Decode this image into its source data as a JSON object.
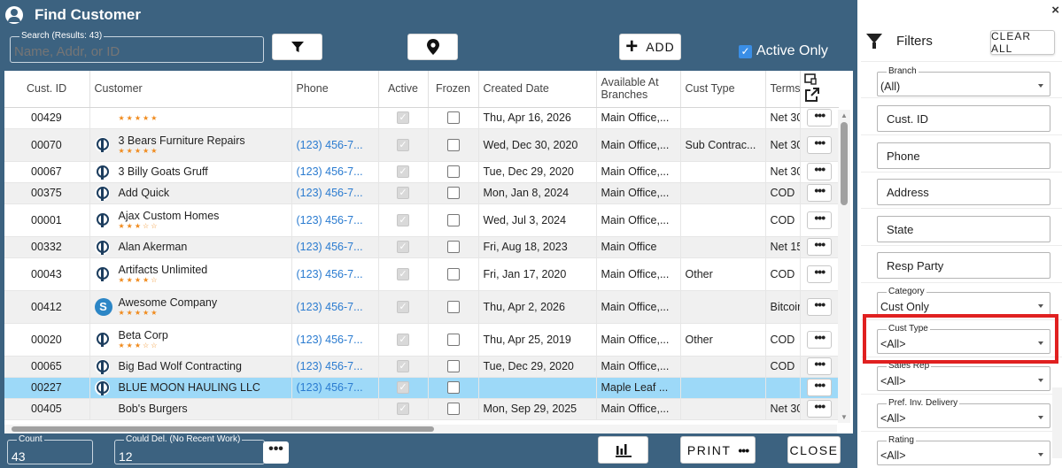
{
  "window": {
    "title": "Find Customer"
  },
  "search": {
    "legend": "Search (Results: 43)",
    "placeholder": "Name, Addr, or ID"
  },
  "toolbar": {
    "add_label": "ADD",
    "active_only_label": "Active Only",
    "active_only_checked": true
  },
  "grid": {
    "columns": [
      "Cust. ID",
      "Customer",
      "Phone",
      "Active",
      "Frozen",
      "Created Date",
      "Available At Branches",
      "Cust Type",
      "Terms"
    ],
    "rows": [
      {
        "id": "00429",
        "name": "",
        "rating": 5,
        "logo": "",
        "phone": "",
        "active": true,
        "frozen": false,
        "created": "Thu, Apr 16, 2026",
        "branches": "Main Office,...",
        "type": "",
        "terms": "Net 30",
        "selected": false
      },
      {
        "id": "00070",
        "name": "3 Bears Furniture Repairs",
        "rating": 5,
        "logo": "p-logo",
        "phone": "(123) 456-7...",
        "active": true,
        "frozen": false,
        "created": "Wed, Dec 30, 2020",
        "branches": "Main Office,...",
        "type": "Sub Contrac...",
        "terms": "Net 30",
        "selected": false
      },
      {
        "id": "00067",
        "name": "3 Billy Goats Gruff",
        "rating": 0,
        "logo": "p-logo",
        "phone": "(123) 456-7...",
        "active": true,
        "frozen": false,
        "created": "Tue, Dec 29, 2020",
        "branches": "Main Office,...",
        "type": "",
        "terms": "Net 30",
        "selected": false
      },
      {
        "id": "00375",
        "name": "Add Quick",
        "rating": 0,
        "logo": "p-logo",
        "phone": "(123) 456-7...",
        "active": true,
        "frozen": false,
        "created": "Mon, Jan 8, 2024",
        "branches": "Main Office,...",
        "type": "",
        "terms": "COD",
        "selected": false
      },
      {
        "id": "00001",
        "name": "Ajax Custom Homes",
        "rating": 3,
        "logo": "p-logo",
        "phone": "(123) 456-7...",
        "active": true,
        "frozen": false,
        "created": "Wed, Jul 3, 2024",
        "branches": "Main Office,...",
        "type": "",
        "terms": "COD",
        "selected": false
      },
      {
        "id": "00332",
        "name": "Alan Akerman",
        "rating": 0,
        "logo": "p-logo",
        "phone": "(123) 456-7...",
        "active": true,
        "frozen": false,
        "created": "Fri, Aug 18, 2023",
        "branches": "Main Office",
        "type": "",
        "terms": "Net 15",
        "selected": false
      },
      {
        "id": "00043",
        "name": "Artifacts Unlimited",
        "rating": 4,
        "logo": "p-logo",
        "phone": "(123) 456-7...",
        "active": true,
        "frozen": false,
        "created": "Fri, Jan 17, 2020",
        "branches": "Main Office,...",
        "type": "Other",
        "terms": "COD",
        "selected": false
      },
      {
        "id": "00412",
        "name": "Awesome Company",
        "rating": 5,
        "logo": "s-logo",
        "phone": "(123) 456-7...",
        "active": true,
        "frozen": false,
        "created": "Thu, Apr 2, 2026",
        "branches": "Main Office,...",
        "type": "",
        "terms": "Bitcoin",
        "selected": false
      },
      {
        "id": "00020",
        "name": "Beta Corp",
        "rating": 3,
        "logo": "p-logo",
        "phone": "(123) 456-7...",
        "active": true,
        "frozen": false,
        "created": "Thu, Apr 25, 2019",
        "branches": "Main Office,...",
        "type": "Other",
        "terms": "COD",
        "selected": false
      },
      {
        "id": "00065",
        "name": "Big Bad Wolf Contracting",
        "rating": 0,
        "logo": "p-logo",
        "phone": "(123) 456-7...",
        "active": true,
        "frozen": false,
        "created": "Tue, Dec 29, 2020",
        "branches": "Main Office,...",
        "type": "",
        "terms": "COD",
        "selected": false
      },
      {
        "id": "00227",
        "name": "BLUE MOON HAULING LLC",
        "rating": 0,
        "logo": "p-logo",
        "phone": "(123) 456-7...",
        "active": true,
        "frozen": false,
        "created": "",
        "branches": "Maple Leaf ...",
        "type": "",
        "terms": "",
        "selected": true
      },
      {
        "id": "00405",
        "name": "Bob's Burgers",
        "rating": 0,
        "logo": "",
        "phone": "",
        "active": true,
        "frozen": false,
        "created": "Mon, Sep 29, 2025",
        "branches": "Main Office,...",
        "type": "",
        "terms": "Net 30",
        "selected": false
      }
    ]
  },
  "footer": {
    "count_legend": "Count",
    "count_value": "43",
    "could_del_legend": "Could Del. (No Recent Work)",
    "could_del_value": "12",
    "print_label": "PRINT",
    "close_label": "CLOSE"
  },
  "filters": {
    "title": "Filters",
    "clear_label": "CLEAR ALL",
    "branch": {
      "legend": "Branch",
      "value": "(All)"
    },
    "cust_id": "Cust. ID",
    "phone": "Phone",
    "address": "Address",
    "state": "State",
    "resp_party": "Resp Party",
    "category": {
      "legend": "Category",
      "value": "Cust Only"
    },
    "cust_type": {
      "legend": "Cust Type",
      "value": "<All>"
    },
    "sales_rep": {
      "legend": "Sales Rep",
      "value": "<All>"
    },
    "pref_inv": {
      "legend": "Pref. Inv. Delivery",
      "value": "<All>"
    },
    "rating": {
      "legend": "Rating",
      "value": "<All>"
    }
  },
  "colors": {
    "header_bg": "#3c6280",
    "selected_row": "#9dd9f8",
    "phone_link": "#2a7bd0",
    "star": "#f08a1c",
    "highlight": "#e02020"
  }
}
